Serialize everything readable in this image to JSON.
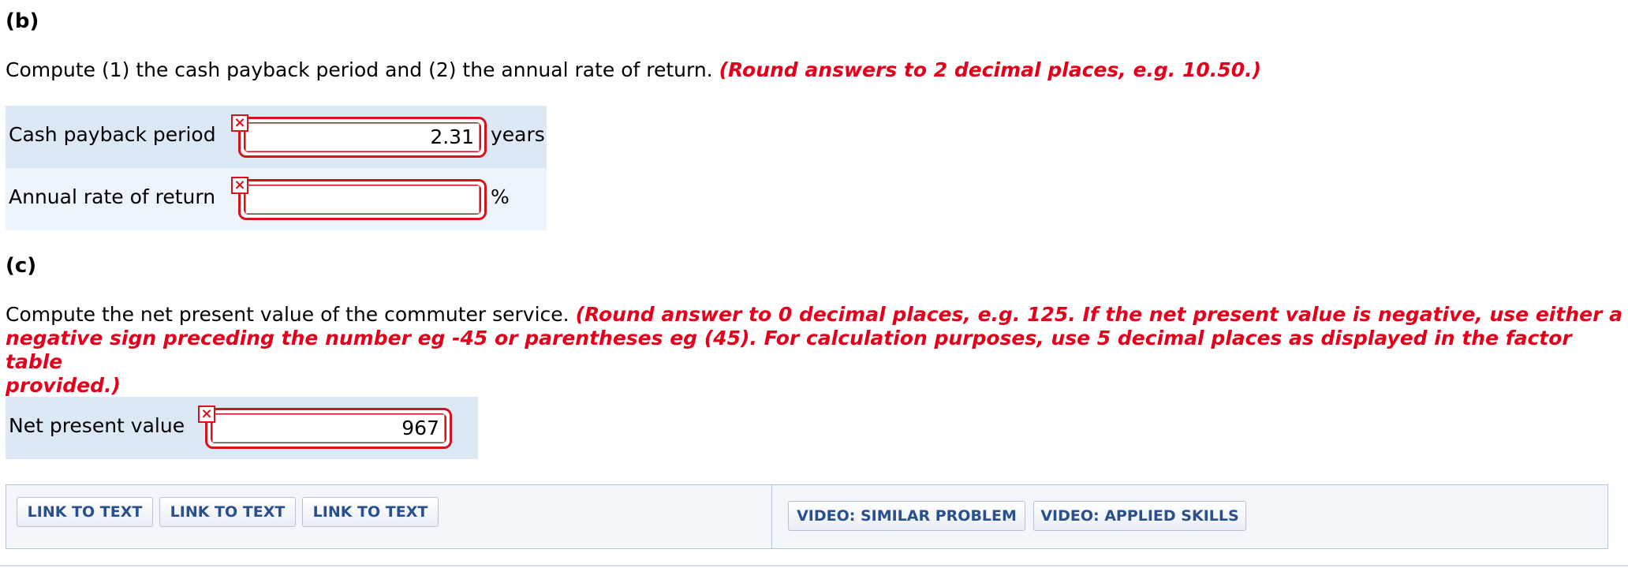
{
  "part_b": {
    "heading": "(b)",
    "instruction": "Compute (1) the cash payback period and (2) the annual rate of return.",
    "instruction_red": "(Round answers to 2 decimal places, e.g. 10.50.)",
    "rows": [
      {
        "label": "Cash payback period",
        "value": "2.31",
        "unit": "years"
      },
      {
        "label": "Annual rate of return",
        "value": "",
        "unit": "%"
      }
    ]
  },
  "part_c": {
    "heading": "(c)",
    "instruction": "Compute the net present value of the commuter service.",
    "instruction_red_line1": "(Round answer to 0 decimal places, e.g. 125. If the net present value is negative, use either a",
    "instruction_red_line2": "negative sign preceding the number eg -45 or parentheses eg (45). For calculation purposes, use 5 decimal places as displayed in the factor table",
    "instruction_red_line3": "provided.)",
    "rows": [
      {
        "label": "Net present value",
        "value": "967"
      }
    ]
  },
  "error_icon": "×",
  "footer": {
    "left_buttons": [
      "LINK TO TEXT",
      "LINK TO TEXT",
      "LINK TO TEXT"
    ],
    "right_buttons": [
      "VIDEO: SIMILAR PROBLEM",
      "VIDEO: APPLIED SKILLS"
    ]
  },
  "colors": {
    "error_red": "#d4141c",
    "instruction_red": "#e4001b",
    "link_blue": "#2a4f8f",
    "row_shade": "#dde8f5"
  }
}
